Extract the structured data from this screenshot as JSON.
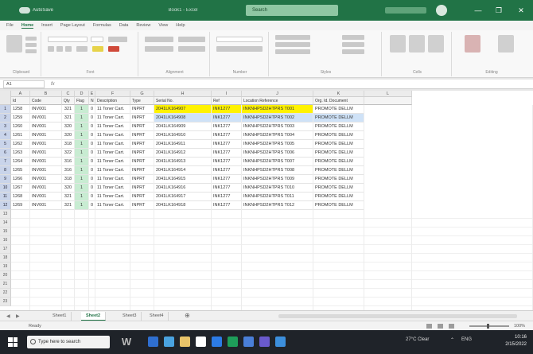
{
  "window": {
    "autosave_label": "AutoSave",
    "file_name": "Book1 - Excel",
    "search_placeholder": "Search",
    "controls": [
      "—",
      "❐",
      "✕"
    ]
  },
  "ribbon_tabs": [
    "File",
    "Home",
    "Insert",
    "Page Layout",
    "Formulas",
    "Data",
    "Review",
    "View",
    "Help"
  ],
  "ribbon_groups": [
    "Clipboard",
    "Font",
    "Alignment",
    "Number",
    "Styles",
    "Cells",
    "Editing"
  ],
  "formula_bar": {
    "name_box": "A1",
    "fx": "fx"
  },
  "columns": [
    "A",
    "B",
    "C",
    "D",
    "E",
    "F",
    "G",
    "H",
    "I",
    "J",
    "K",
    "L"
  ],
  "field_headers": [
    "Id",
    "Code",
    "Qty",
    "Flag",
    "N",
    "Description",
    "Type",
    "Serial No.",
    "Ref",
    "Location Reference",
    "Org. Id. Document",
    ""
  ],
  "row_numbers": [
    "1",
    "2",
    "3",
    "4",
    "5",
    "6",
    "7",
    "8",
    "9",
    "10",
    "11",
    "12",
    "13",
    "14",
    "15",
    "16",
    "17",
    "18",
    "19",
    "20",
    "21",
    "22",
    "23"
  ],
  "rows": [
    [
      "1258",
      "INV001",
      "321",
      "1",
      "0",
      "11 Toner Cart.",
      "INPRT",
      "2041LK164907",
      "INK1277",
      "INKNHPSD2HTPRS T001",
      "PROMOTE DELLM"
    ],
    [
      "1259",
      "INV001",
      "321",
      "1",
      "0",
      "11 Toner Cart.",
      "INPRT",
      "2041LK164908",
      "INK1277",
      "INKNHPSD2HTPRS T002",
      "PROMOTE DELLM"
    ],
    [
      "1260",
      "INV001",
      "320",
      "1",
      "0",
      "11 Toner Cart.",
      "INPRT",
      "2041LK164909",
      "INK1277",
      "INKNHPSD2HTPRS T003",
      "PROMOTE DELLM"
    ],
    [
      "1261",
      "INV001",
      "320",
      "1",
      "0",
      "11 Toner Cart.",
      "INPRT",
      "2041LK164910",
      "INK1277",
      "INKNHPSD2HTPRS T004",
      "PROMOTE DELLM"
    ],
    [
      "1262",
      "INV001",
      "318",
      "1",
      "0",
      "11 Toner Cart.",
      "INPRT",
      "2041LK164911",
      "INK1277",
      "INKNHPSD2HTPRS T005",
      "PROMOTE DELLM"
    ],
    [
      "1263",
      "INV001",
      "322",
      "1",
      "0",
      "11 Toner Cart.",
      "INPRT",
      "2041LK164912",
      "INK1277",
      "INKNHPSD2HTPRS T006",
      "PROMOTE DELLM"
    ],
    [
      "1264",
      "INV001",
      "316",
      "1",
      "0",
      "11 Toner Cart.",
      "INPRT",
      "2041LK164913",
      "INK1277",
      "INKNHPSD2HTPRS T007",
      "PROMOTE DELLM"
    ],
    [
      "1265",
      "INV001",
      "316",
      "1",
      "0",
      "11 Toner Cart.",
      "INPRT",
      "2041LK164914",
      "INK1277",
      "INKNHPSD2HTPRS T008",
      "PROMOTE DELLM"
    ],
    [
      "1266",
      "INV001",
      "318",
      "1",
      "0",
      "11 Toner Cart.",
      "INPRT",
      "2041LK164915",
      "INK1277",
      "INKNHPSD2HTPRS T009",
      "PROMOTE DELLM"
    ],
    [
      "1267",
      "INV001",
      "320",
      "1",
      "0",
      "11 Toner Cart.",
      "INPRT",
      "2041LK164916",
      "INK1277",
      "INKNHPSD2HTPRS T010",
      "PROMOTE DELLM"
    ],
    [
      "1268",
      "INV001",
      "321",
      "1",
      "0",
      "11 Toner Cart.",
      "INPRT",
      "2041LK164917",
      "INK1277",
      "INKNHPSD2HTPRS T011",
      "PROMOTE DELLM"
    ],
    [
      "1269",
      "INV001",
      "321",
      "1",
      "0",
      "11 Toner Cart.",
      "INPRT",
      "2041LK164918",
      "INK1277",
      "INKNHPSD2HTPRS T012",
      "PROMOTE DELLM"
    ]
  ],
  "sheet_tabs": [
    "Sheet1",
    "Sheet2",
    "Sheet3",
    "Sheet4"
  ],
  "active_sheet_index": 1,
  "status": {
    "left": "Ready",
    "zoom": "100%"
  },
  "taskbar": {
    "search_placeholder": "Type here to search",
    "time": "10:16",
    "date": "2/15/2022",
    "weather": "27°C Clear",
    "lang": "ENG"
  },
  "colors": {
    "excel_green": "#217346",
    "highlight_yellow": "#fff200",
    "highlight_blue": "#cfe2f7",
    "highlight_green": "#c8ecd2"
  }
}
